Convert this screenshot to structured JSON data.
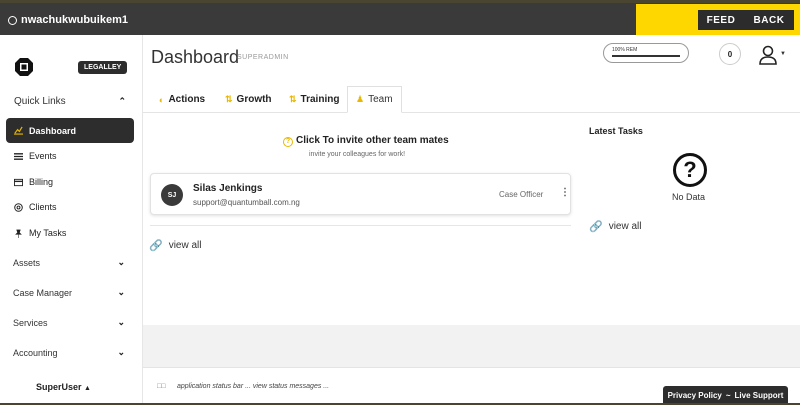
{
  "topbar": {
    "username": "nwachukwubuikem1",
    "feed_label": "FEED",
    "back_label": "BACK"
  },
  "sidebar": {
    "badge": "LEGALLEY",
    "quick_links_label": "Quick Links",
    "items": [
      {
        "label": "Dashboard",
        "icon": "chart-icon"
      },
      {
        "label": "Events",
        "icon": "list-icon"
      },
      {
        "label": "Billing",
        "icon": "card-icon"
      },
      {
        "label": "Clients",
        "icon": "at-icon"
      },
      {
        "label": "My Tasks",
        "icon": "pin-icon"
      }
    ],
    "sections": [
      {
        "label": "Assets"
      },
      {
        "label": "Case Manager"
      },
      {
        "label": "Services"
      },
      {
        "label": "Accounting"
      }
    ],
    "footer_user": "SuperUser"
  },
  "header": {
    "title": "Dashboard",
    "role": "SUPERADMIN",
    "rem_label": "100% REM",
    "rem_fraction": 1.0,
    "notification_count": "0"
  },
  "tabs": [
    {
      "label": "Actions"
    },
    {
      "label": "Growth"
    },
    {
      "label": "Training"
    },
    {
      "label": "Team",
      "active": true
    }
  ],
  "team": {
    "invite_title": "Click To invite other team mates",
    "invite_subtitle": "invite your colleagues for work!",
    "members": [
      {
        "initials": "SJ",
        "name": "Silas Jenkings",
        "email": "support@quantumball.com.ng",
        "role": "Case Officer"
      }
    ],
    "view_all": "view all"
  },
  "latest_tasks": {
    "title": "Latest Tasks",
    "empty_label": "No Data",
    "view_all": "view all"
  },
  "status": {
    "text": "application status bar ... view status messages ...",
    "footer_links": {
      "privacy": "Privacy Policy",
      "separator": "~",
      "support": "Live Support"
    }
  },
  "colors": {
    "accent": "#ffd700",
    "dark": "#2d2d2d",
    "icon_yellow": "#e8b800"
  }
}
